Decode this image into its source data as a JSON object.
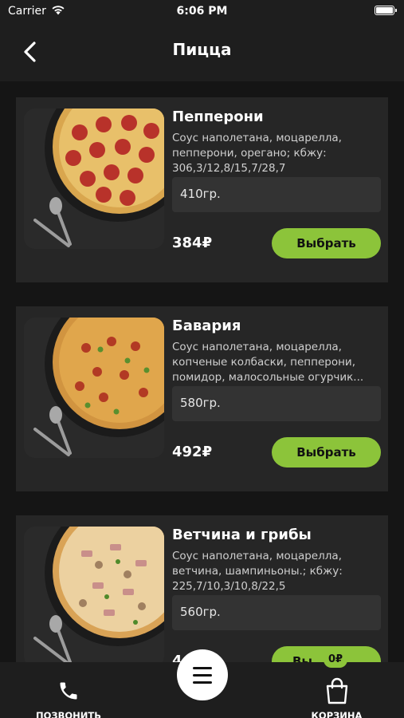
{
  "status_bar": {
    "carrier": "Carrier",
    "time": "6:06 PM"
  },
  "nav": {
    "title": "Пицца"
  },
  "products": [
    {
      "name": "Пепперони",
      "description": "Соус наполетана, моцарелла, пепперони, орегано; кбжу: 306,3/12,8/15,7/28,7",
      "weight": "410гр.",
      "price": "384₽",
      "button": "Выбрать"
    },
    {
      "name": "Бавария",
      "description": "Соус наполетана, моцарелла, копченые колбаски, пепперони, помидор, малосольные огурчик...",
      "weight": "580гр.",
      "price": "492₽",
      "button": "Выбрать"
    },
    {
      "name": "Ветчина и грибы",
      "description": "Соус наполетана, моцарелла, ветчина, шампиньоны.; кбжу: 225,7/10,3/10,8/22,5",
      "weight": "560гр.",
      "price": "4",
      "button": "Вы"
    }
  ],
  "tab_bar": {
    "call_label": "ПОЗВОНИТЬ",
    "cart_label": "КОРЗИНА",
    "cart_badge": "0₽"
  },
  "colors": {
    "accent": "#8cc43a",
    "background": "#151515",
    "card": "#262626",
    "bar": "#1e1e1e"
  },
  "icons": [
    "wifi-icon",
    "battery-icon",
    "back-chevron-icon",
    "phone-icon",
    "menu-icon",
    "shopping-bag-icon"
  ]
}
